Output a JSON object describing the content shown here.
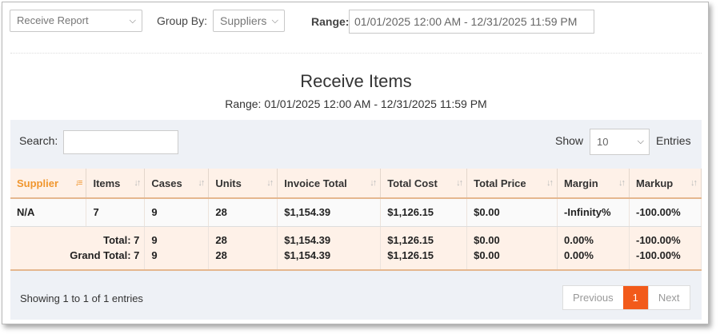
{
  "toolbar": {
    "report_select": "Receive Report",
    "group_by_label": "Group By:",
    "group_by_value": "Suppliers",
    "range_label": "Range:",
    "range_value": "01/01/2025 12:00 AM - 12/31/2025 11:59 PM"
  },
  "report": {
    "title": "Receive Items",
    "subtitle": "Range: 01/01/2025 12:00 AM - 12/31/2025 11:59 PM"
  },
  "table_controls": {
    "search_label": "Search:",
    "search_value": "",
    "show_label": "Show",
    "page_length": "10",
    "entries_label": "Entries"
  },
  "table": {
    "columns": [
      "Supplier",
      "Items",
      "Cases",
      "Units",
      "Invoice Total",
      "Total Cost",
      "Total Price",
      "Margin",
      "Markup"
    ],
    "rows": [
      [
        "N/A",
        "7",
        "9",
        "28",
        "$1,154.39",
        "$1,126.15",
        "$0.00",
        "-Infinity%",
        "-100.00%"
      ]
    ],
    "totals": {
      "total_label": "Total: 7",
      "grand_total_label": "Grand Total: 7",
      "cases": [
        "9",
        "9"
      ],
      "units": [
        "28",
        "28"
      ],
      "invoice_total": [
        "$1,154.39",
        "$1,154.39"
      ],
      "total_cost": [
        "$1,126.15",
        "$1,126.15"
      ],
      "total_price": [
        "$0.00",
        "$0.00"
      ],
      "margin": [
        "0.00%",
        "0.00%"
      ],
      "markup": [
        "-100.00%",
        "-100.00%"
      ]
    }
  },
  "footer": {
    "info": "Showing 1 to 1 of 1 entries",
    "pagination": {
      "previous": "Previous",
      "current": "1",
      "next": "Next"
    }
  },
  "colors": {
    "accent": "#f25a1a",
    "active_sort": "#f0962e",
    "header_bg": "#fef1e8",
    "panel_bg": "#eef1f6"
  }
}
